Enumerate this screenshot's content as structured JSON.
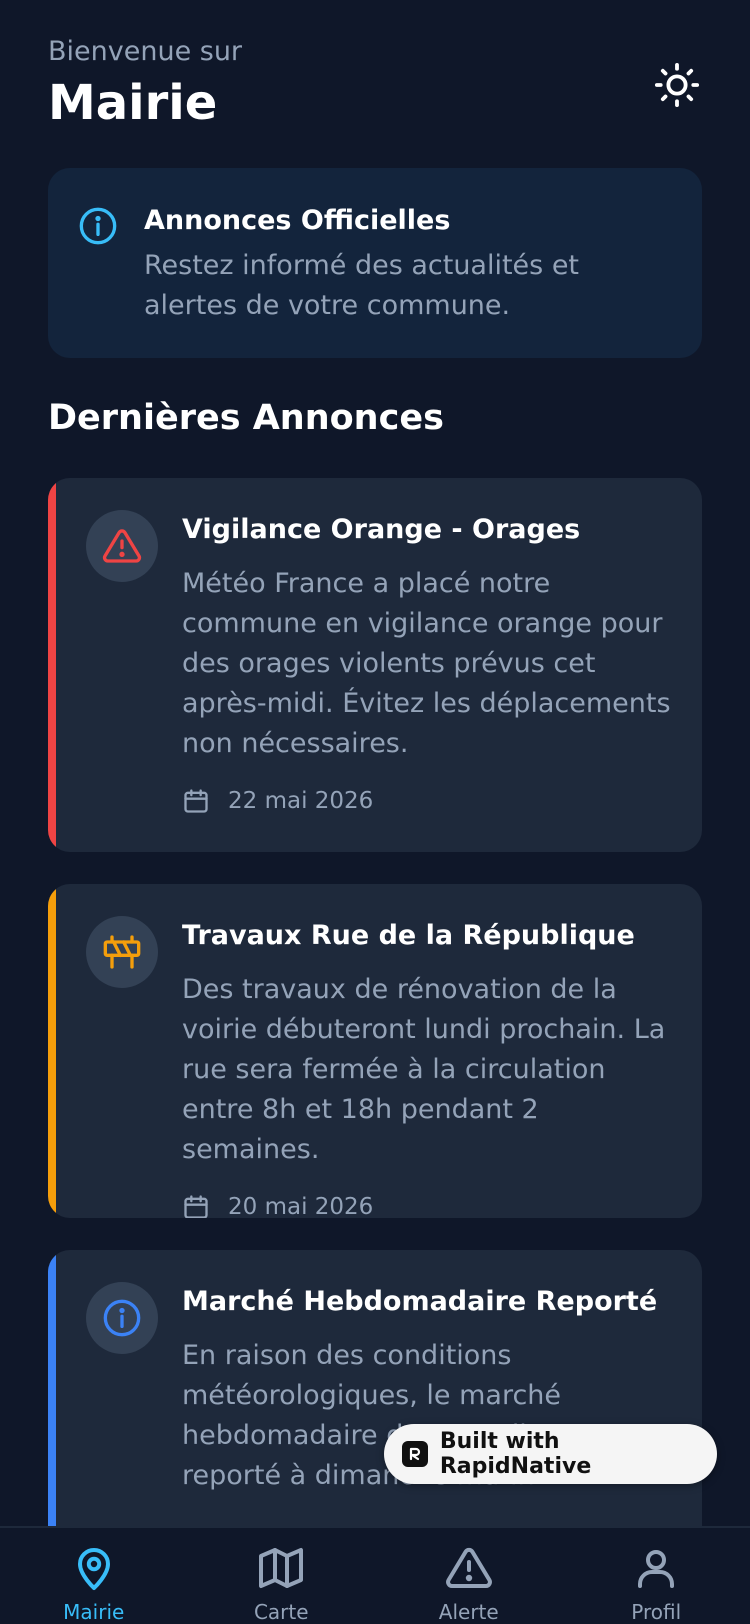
{
  "header": {
    "welcome": "Bienvenue sur",
    "title": "Mairie"
  },
  "info_card": {
    "title": "Annonces Officielles",
    "description": "Restez informé des actualités et alertes de votre commune."
  },
  "section_title": "Dernières Annonces",
  "announcements": [
    {
      "title": "Vigilance Orange - Orages",
      "description": "Météo France a placé notre commune en vigilance orange pour des orages violents prévus cet après-midi. Évitez les déplacements non nécessaires.",
      "date": "22 mai 2026",
      "icon": "warning-icon",
      "color": "#ef4444"
    },
    {
      "title": "Travaux Rue de la République",
      "description": "Des travaux de rénovation de la voirie débuteront lundi prochain. La rue sera fermée à la circulation entre 8h et 18h pendant 2 semaines.",
      "date": "20 mai 2026",
      "icon": "roadwork-barrier-icon",
      "color": "#f59e0b"
    },
    {
      "title": "Marché Hebdomadaire Reporté",
      "description": "En raison des conditions météorologiques, le marché hebdomadaire de samedi est reporté à dimanche matin.",
      "date": "",
      "icon": "info-icon",
      "color": "#3b82f6"
    }
  ],
  "badge": {
    "label": "Built with RapidNative"
  },
  "tabs": [
    {
      "label": "Mairie",
      "icon": "map-pin-icon",
      "active": true
    },
    {
      "label": "Carte",
      "icon": "map-icon",
      "active": false
    },
    {
      "label": "Alerte",
      "icon": "alert-triangle-icon",
      "active": false
    },
    {
      "label": "Profil",
      "icon": "user-icon",
      "active": false
    }
  ],
  "colors": {
    "background": "#0f1729",
    "card": "#1e293b",
    "info_card": "#13243c",
    "accent": "#38bdf8",
    "muted_text": "#94a3b8"
  }
}
